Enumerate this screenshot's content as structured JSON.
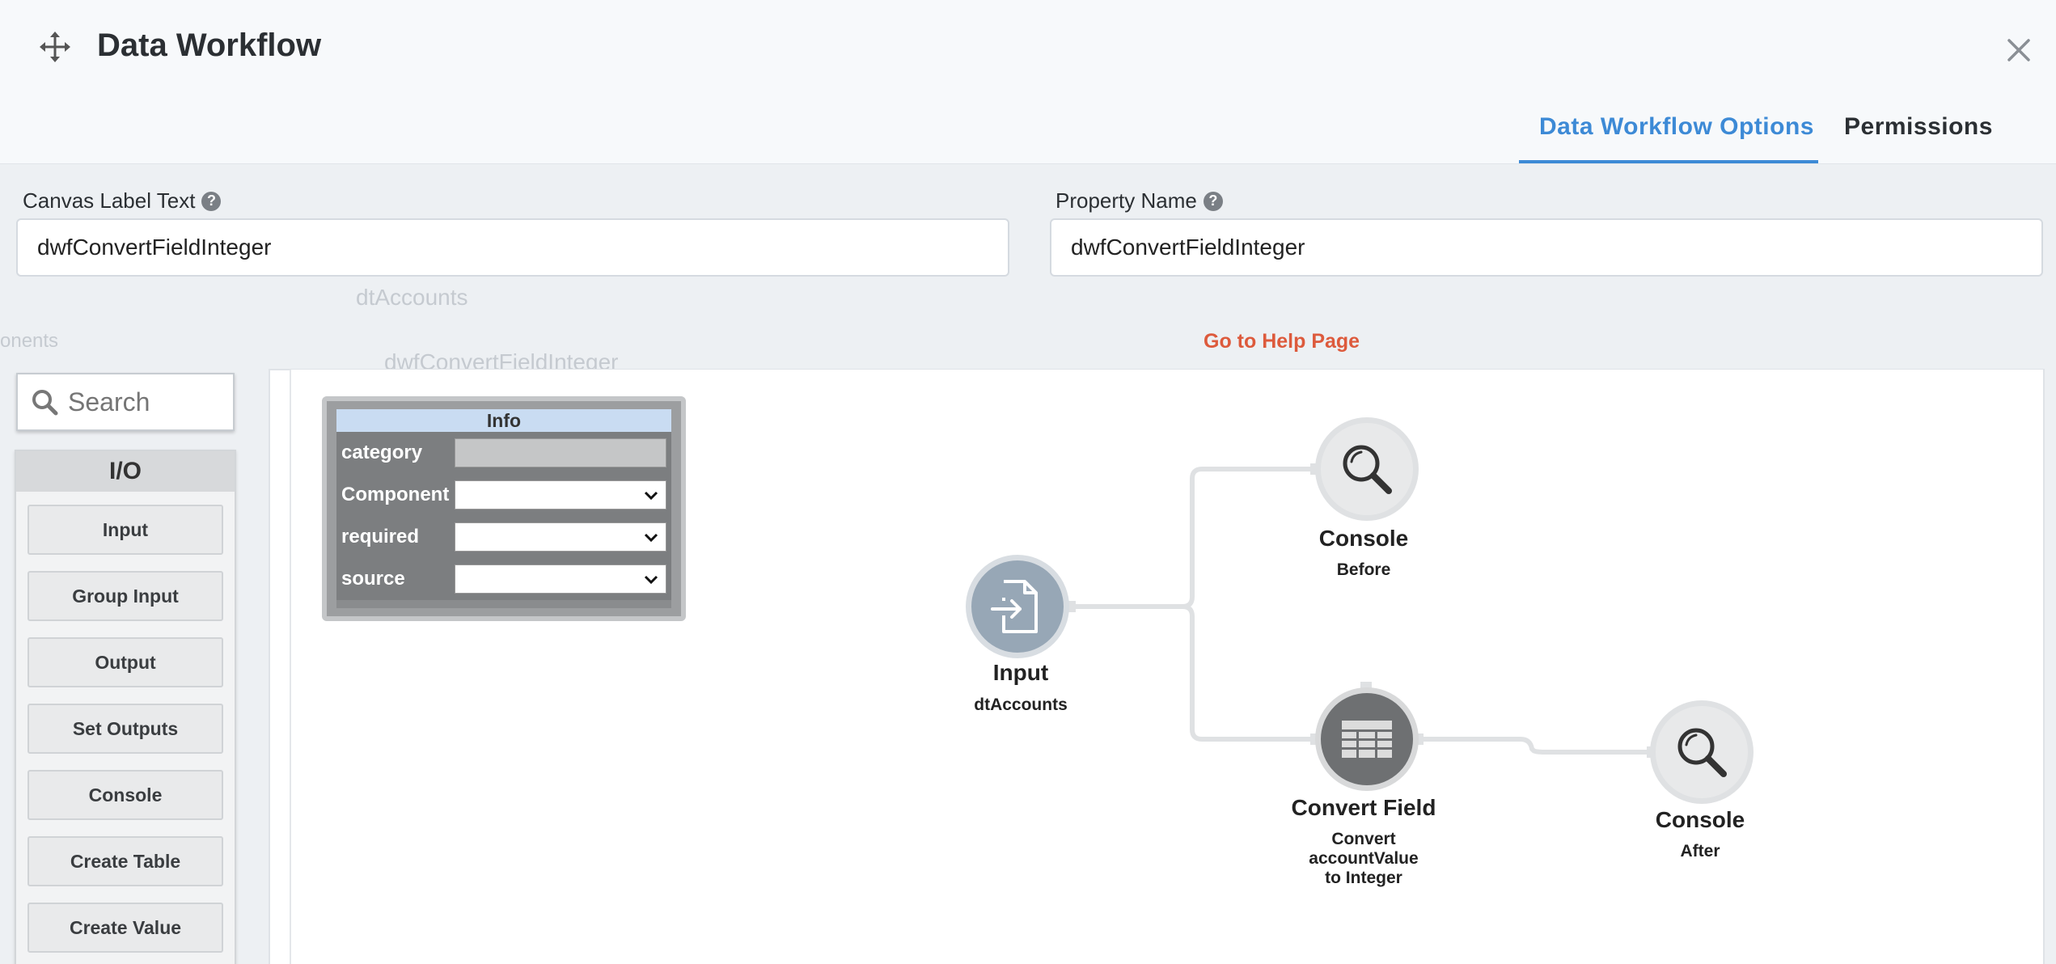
{
  "modal": {
    "title": "Data Workflow",
    "tabs": [
      {
        "label": "Data Workflow Options",
        "active": true
      },
      {
        "label": "Permissions",
        "active": false
      }
    ]
  },
  "form": {
    "canvas_label": {
      "label": "Canvas Label Text",
      "value": "dwfConvertFieldInteger"
    },
    "property_name": {
      "label": "Property Name",
      "value": "dwfConvertFieldInteger"
    },
    "help_link": "Go to Help Page"
  },
  "background": {
    "ghost_1": "dtAccounts",
    "ghost_2": "dwfConvertFieldInteger",
    "ghost_3": "onents"
  },
  "palette": {
    "search_placeholder": "Search",
    "section": "I/O",
    "items": [
      "Input",
      "Group Input",
      "Output",
      "Set Outputs",
      "Console",
      "Create Table",
      "Create Value"
    ]
  },
  "info_panel": {
    "title": "Info",
    "rows": [
      {
        "key": "category",
        "value": ""
      },
      {
        "key": "Component",
        "value": ""
      },
      {
        "key": "required",
        "value": ""
      },
      {
        "key": "source",
        "value": ""
      }
    ]
  },
  "nodes": {
    "input": {
      "title": "Input",
      "sub": "dtAccounts"
    },
    "console_before": {
      "title": "Console",
      "sub": "Before"
    },
    "convert_field": {
      "title": "Convert Field",
      "sub_1": "Convert",
      "sub_2": "accountValue",
      "sub_3": "to Integer"
    },
    "console_after": {
      "title": "Console",
      "sub": "After"
    }
  },
  "colors": {
    "accent": "#3d8ad6",
    "help_link": "#dd5a3c",
    "info_header": "#c9dcf2"
  },
  "icons": {
    "move": "move-arrows-icon",
    "close": "close-icon",
    "help": "question-circle-icon",
    "search": "search-icon",
    "input_node": "file-import-icon",
    "console_node": "magnifier-icon",
    "convert_node": "table-icon",
    "chevron": "chevron-down-icon"
  }
}
